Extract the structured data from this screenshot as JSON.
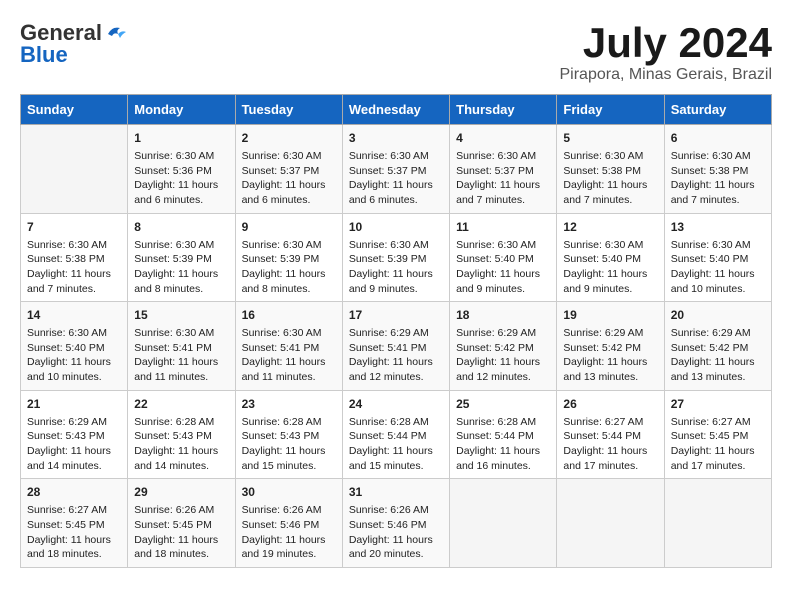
{
  "header": {
    "logo_general": "General",
    "logo_blue": "Blue",
    "month_title": "July 2024",
    "location": "Pirapora, Minas Gerais, Brazil"
  },
  "days_of_week": [
    "Sunday",
    "Monday",
    "Tuesday",
    "Wednesday",
    "Thursday",
    "Friday",
    "Saturday"
  ],
  "weeks": [
    [
      {
        "num": "",
        "detail": ""
      },
      {
        "num": "1",
        "detail": "Sunrise: 6:30 AM\nSunset: 5:36 PM\nDaylight: 11 hours\nand 6 minutes."
      },
      {
        "num": "2",
        "detail": "Sunrise: 6:30 AM\nSunset: 5:37 PM\nDaylight: 11 hours\nand 6 minutes."
      },
      {
        "num": "3",
        "detail": "Sunrise: 6:30 AM\nSunset: 5:37 PM\nDaylight: 11 hours\nand 6 minutes."
      },
      {
        "num": "4",
        "detail": "Sunrise: 6:30 AM\nSunset: 5:37 PM\nDaylight: 11 hours\nand 7 minutes."
      },
      {
        "num": "5",
        "detail": "Sunrise: 6:30 AM\nSunset: 5:38 PM\nDaylight: 11 hours\nand 7 minutes."
      },
      {
        "num": "6",
        "detail": "Sunrise: 6:30 AM\nSunset: 5:38 PM\nDaylight: 11 hours\nand 7 minutes."
      }
    ],
    [
      {
        "num": "7",
        "detail": "Sunrise: 6:30 AM\nSunset: 5:38 PM\nDaylight: 11 hours\nand 7 minutes."
      },
      {
        "num": "8",
        "detail": "Sunrise: 6:30 AM\nSunset: 5:39 PM\nDaylight: 11 hours\nand 8 minutes."
      },
      {
        "num": "9",
        "detail": "Sunrise: 6:30 AM\nSunset: 5:39 PM\nDaylight: 11 hours\nand 8 minutes."
      },
      {
        "num": "10",
        "detail": "Sunrise: 6:30 AM\nSunset: 5:39 PM\nDaylight: 11 hours\nand 9 minutes."
      },
      {
        "num": "11",
        "detail": "Sunrise: 6:30 AM\nSunset: 5:40 PM\nDaylight: 11 hours\nand 9 minutes."
      },
      {
        "num": "12",
        "detail": "Sunrise: 6:30 AM\nSunset: 5:40 PM\nDaylight: 11 hours\nand 9 minutes."
      },
      {
        "num": "13",
        "detail": "Sunrise: 6:30 AM\nSunset: 5:40 PM\nDaylight: 11 hours\nand 10 minutes."
      }
    ],
    [
      {
        "num": "14",
        "detail": "Sunrise: 6:30 AM\nSunset: 5:40 PM\nDaylight: 11 hours\nand 10 minutes."
      },
      {
        "num": "15",
        "detail": "Sunrise: 6:30 AM\nSunset: 5:41 PM\nDaylight: 11 hours\nand 11 minutes."
      },
      {
        "num": "16",
        "detail": "Sunrise: 6:30 AM\nSunset: 5:41 PM\nDaylight: 11 hours\nand 11 minutes."
      },
      {
        "num": "17",
        "detail": "Sunrise: 6:29 AM\nSunset: 5:41 PM\nDaylight: 11 hours\nand 12 minutes."
      },
      {
        "num": "18",
        "detail": "Sunrise: 6:29 AM\nSunset: 5:42 PM\nDaylight: 11 hours\nand 12 minutes."
      },
      {
        "num": "19",
        "detail": "Sunrise: 6:29 AM\nSunset: 5:42 PM\nDaylight: 11 hours\nand 13 minutes."
      },
      {
        "num": "20",
        "detail": "Sunrise: 6:29 AM\nSunset: 5:42 PM\nDaylight: 11 hours\nand 13 minutes."
      }
    ],
    [
      {
        "num": "21",
        "detail": "Sunrise: 6:29 AM\nSunset: 5:43 PM\nDaylight: 11 hours\nand 14 minutes."
      },
      {
        "num": "22",
        "detail": "Sunrise: 6:28 AM\nSunset: 5:43 PM\nDaylight: 11 hours\nand 14 minutes."
      },
      {
        "num": "23",
        "detail": "Sunrise: 6:28 AM\nSunset: 5:43 PM\nDaylight: 11 hours\nand 15 minutes."
      },
      {
        "num": "24",
        "detail": "Sunrise: 6:28 AM\nSunset: 5:44 PM\nDaylight: 11 hours\nand 15 minutes."
      },
      {
        "num": "25",
        "detail": "Sunrise: 6:28 AM\nSunset: 5:44 PM\nDaylight: 11 hours\nand 16 minutes."
      },
      {
        "num": "26",
        "detail": "Sunrise: 6:27 AM\nSunset: 5:44 PM\nDaylight: 11 hours\nand 17 minutes."
      },
      {
        "num": "27",
        "detail": "Sunrise: 6:27 AM\nSunset: 5:45 PM\nDaylight: 11 hours\nand 17 minutes."
      }
    ],
    [
      {
        "num": "28",
        "detail": "Sunrise: 6:27 AM\nSunset: 5:45 PM\nDaylight: 11 hours\nand 18 minutes."
      },
      {
        "num": "29",
        "detail": "Sunrise: 6:26 AM\nSunset: 5:45 PM\nDaylight: 11 hours\nand 18 minutes."
      },
      {
        "num": "30",
        "detail": "Sunrise: 6:26 AM\nSunset: 5:46 PM\nDaylight: 11 hours\nand 19 minutes."
      },
      {
        "num": "31",
        "detail": "Sunrise: 6:26 AM\nSunset: 5:46 PM\nDaylight: 11 hours\nand 20 minutes."
      },
      {
        "num": "",
        "detail": ""
      },
      {
        "num": "",
        "detail": ""
      },
      {
        "num": "",
        "detail": ""
      }
    ]
  ]
}
